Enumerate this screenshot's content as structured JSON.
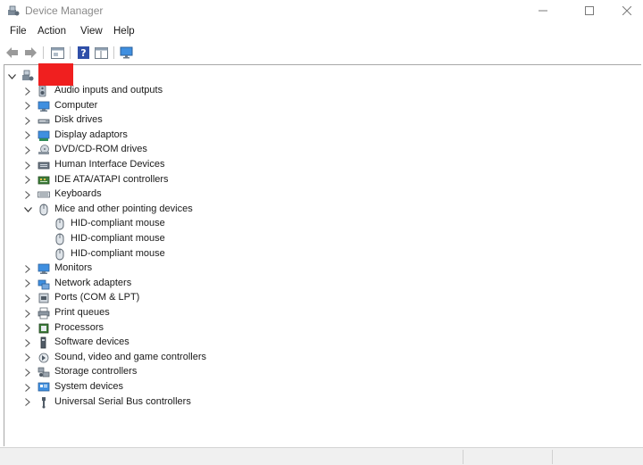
{
  "window": {
    "title": "Device Manager"
  },
  "menu": [
    "File",
    "Action",
    "View",
    "Help"
  ],
  "tree": {
    "root": {
      "label": "",
      "expanded": true
    },
    "categories": [
      {
        "label": "Audio inputs and outputs",
        "icon": "speaker-icon",
        "expanded": false
      },
      {
        "label": "Computer",
        "icon": "computer-icon",
        "expanded": false
      },
      {
        "label": "Disk drives",
        "icon": "disk-drive-icon",
        "expanded": false
      },
      {
        "label": "Display adaptors",
        "icon": "display-adapter-icon",
        "expanded": false
      },
      {
        "label": "DVD/CD-ROM drives",
        "icon": "dvd-drive-icon",
        "expanded": false
      },
      {
        "label": "Human Interface Devices",
        "icon": "hid-icon",
        "expanded": false
      },
      {
        "label": "IDE ATA/ATAPI controllers",
        "icon": "ide-controller-icon",
        "expanded": false
      },
      {
        "label": "Keyboards",
        "icon": "keyboard-icon",
        "expanded": false
      },
      {
        "label": "Mice and other pointing devices",
        "icon": "mouse-icon",
        "expanded": true,
        "children": [
          "HID-compliant mouse",
          "HID-compliant mouse",
          "HID-compliant mouse"
        ]
      },
      {
        "label": "Monitors",
        "icon": "monitor-icon",
        "expanded": false
      },
      {
        "label": "Network adapters",
        "icon": "network-adapter-icon",
        "expanded": false
      },
      {
        "label": "Ports (COM & LPT)",
        "icon": "port-icon",
        "expanded": false
      },
      {
        "label": "Print queues",
        "icon": "printer-icon",
        "expanded": false
      },
      {
        "label": "Processors",
        "icon": "processor-icon",
        "expanded": false
      },
      {
        "label": "Software devices",
        "icon": "software-device-icon",
        "expanded": false
      },
      {
        "label": "Sound, video and game controllers",
        "icon": "sound-controller-icon",
        "expanded": false
      },
      {
        "label": "Storage controllers",
        "icon": "storage-controller-icon",
        "expanded": false
      },
      {
        "label": "System devices",
        "icon": "system-device-icon",
        "expanded": false
      },
      {
        "label": "Universal Serial Bus controllers",
        "icon": "usb-icon",
        "expanded": false
      }
    ]
  },
  "colors": {
    "redacted": "#f01f1f",
    "accent": "#2a7bd8"
  }
}
